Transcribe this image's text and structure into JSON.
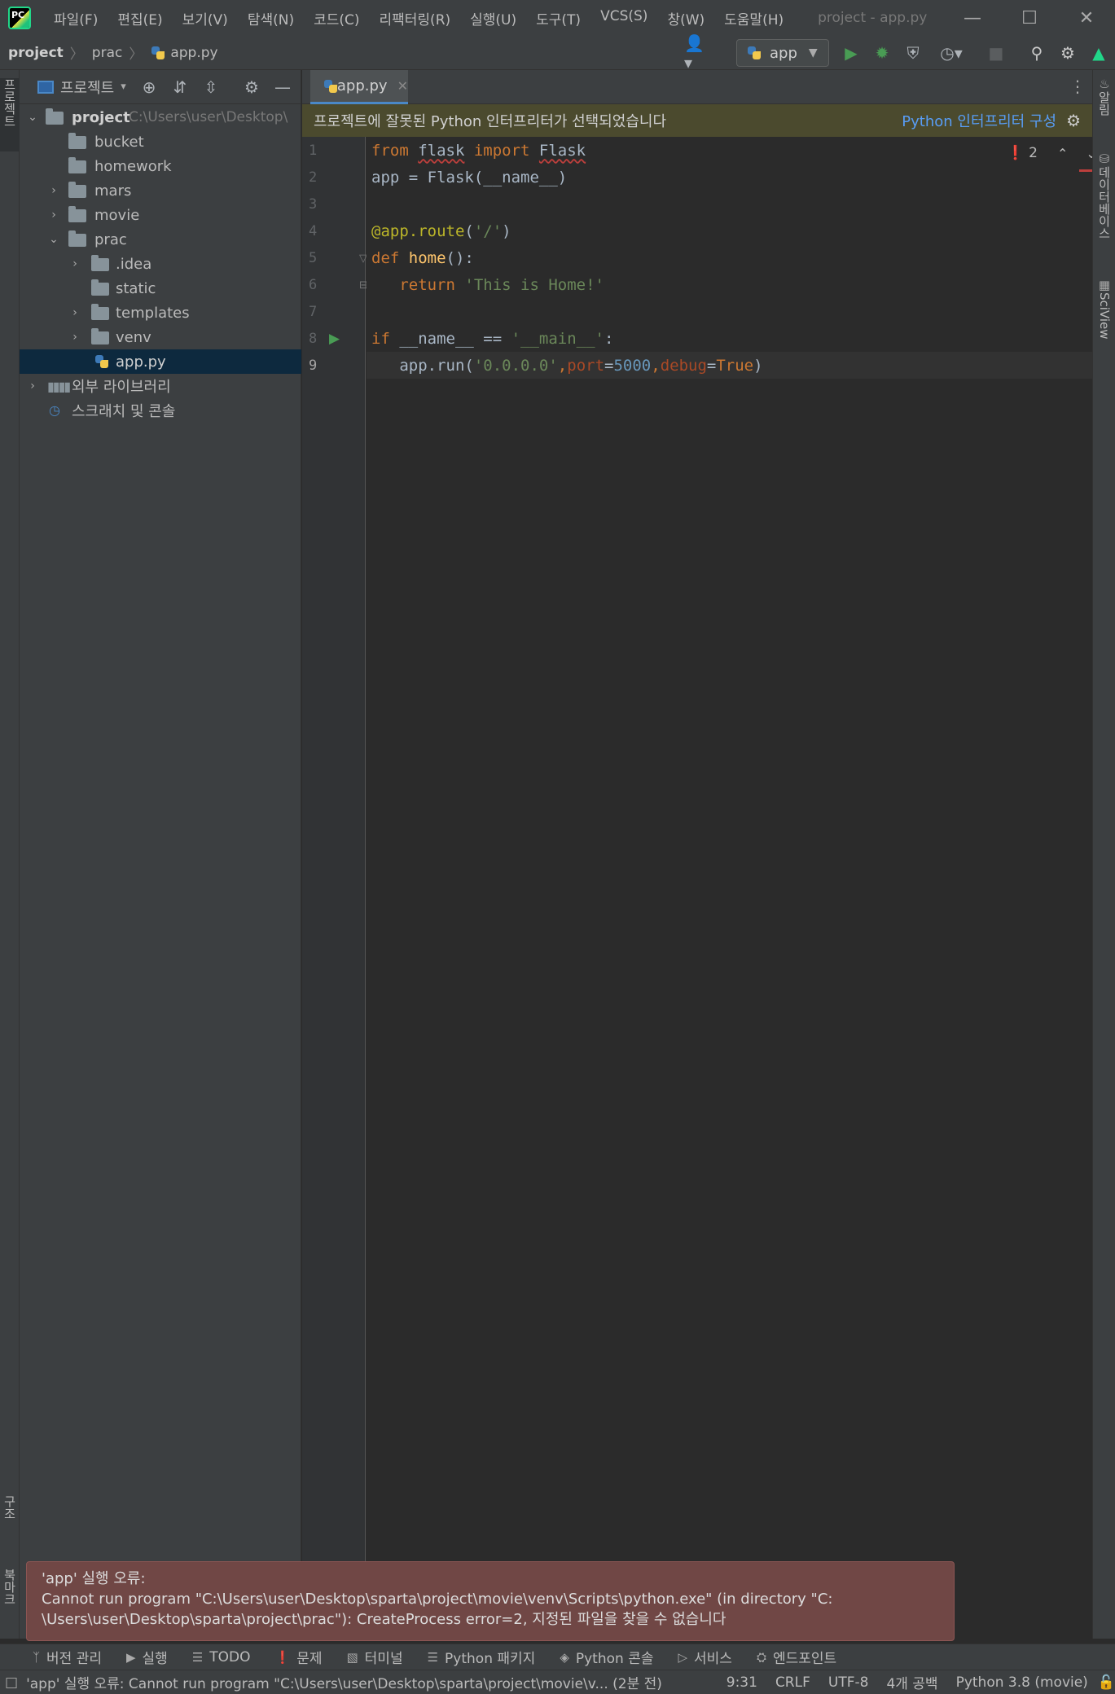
{
  "window": {
    "logo": "PC",
    "title": "project - app.py",
    "menu": [
      "파일(F)",
      "편집(E)",
      "보기(V)",
      "탐색(N)",
      "코드(C)",
      "리팩터링(R)",
      "실행(U)",
      "도구(T)",
      "VCS(S)",
      "창(W)",
      "도움말(H)"
    ]
  },
  "breadcrumb": [
    "project",
    "prac",
    "app.py"
  ],
  "run_config": "app",
  "left_stripe": {
    "top_tab": "프로젝트",
    "structure_tab": "구조",
    "bookmarks_tab": "북마크"
  },
  "right_stripe": {
    "notifications": "알림",
    "database": "데이터베이스",
    "sciview": "SciView"
  },
  "project_panel": {
    "title": "프로젝트",
    "tree": [
      {
        "label": "project",
        "path": "C:\\Users\\user\\Desktop\\",
        "level": 0,
        "expanded": true,
        "type": "folder",
        "bold": true
      },
      {
        "label": "bucket",
        "level": 1,
        "type": "folder"
      },
      {
        "label": "homework",
        "level": 1,
        "type": "folder"
      },
      {
        "label": "mars",
        "level": 1,
        "type": "folder",
        "collapsed": true
      },
      {
        "label": "movie",
        "level": 1,
        "type": "folder",
        "collapsed": true
      },
      {
        "label": "prac",
        "level": 1,
        "type": "folder",
        "expanded": true
      },
      {
        "label": ".idea",
        "level": 2,
        "type": "folder",
        "collapsed": true
      },
      {
        "label": "static",
        "level": 2,
        "type": "folder"
      },
      {
        "label": "templates",
        "level": 2,
        "type": "folder",
        "collapsed": true
      },
      {
        "label": "venv",
        "level": 2,
        "type": "folder",
        "collapsed": true
      },
      {
        "label": "app.py",
        "level": 3,
        "type": "python",
        "selected": true
      },
      {
        "label": "외부 라이브러리",
        "level": 0,
        "type": "library",
        "collapsed": true
      },
      {
        "label": "스크래치 및 콘솔",
        "level": 0,
        "type": "scratch"
      }
    ]
  },
  "editor": {
    "tab": "app.py",
    "banner": "프로젝트에 잘못된 Python 인터프리터가 선택되었습니다",
    "banner_link": "Python 인터프리터 구성",
    "error_count": "2",
    "line_numbers": [
      "1",
      "2",
      "3",
      "4",
      "5",
      "6",
      "7",
      "8",
      "9"
    ],
    "current_line": 9
  },
  "error_popup": {
    "title": "'app' 실행 오류:",
    "line1": "Cannot run program \"C:\\Users\\user\\Desktop\\sparta\\project\\movie\\venv\\Scripts\\python.exe\" (in directory \"C:",
    "line2": "\\Users\\user\\Desktop\\sparta\\project\\prac\"): CreateProcess error=2, 지정된 파일을 찾을 수 없습니다"
  },
  "bottom_toolbar": [
    "버전 관리",
    "실행",
    "TODO",
    "문제",
    "터미널",
    "Python 패키지",
    "Python 콘솔",
    "서비스",
    "엔드포인트"
  ],
  "status_bar": {
    "message": "'app' 실행 오류: Cannot run program \"C:\\Users\\user\\Desktop\\sparta\\project\\movie\\v... (2분 전)",
    "position": "9:31",
    "line_sep": "CRLF",
    "encoding": "UTF-8",
    "indent": "4개 공백",
    "interpreter": "Python 3.8 (movie)"
  },
  "colors": {
    "accent_blue": "#589df6",
    "run_green": "#499c54",
    "error_red": "#bc3f3c",
    "selection": "#0d293e"
  }
}
